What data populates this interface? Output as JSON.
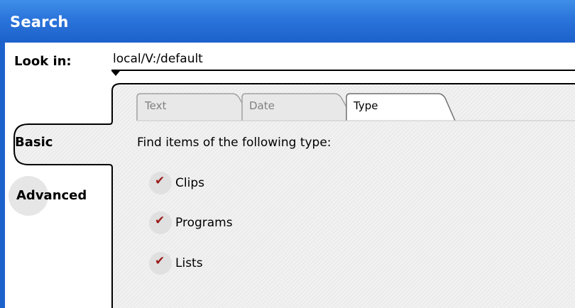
{
  "window": {
    "title": "Search"
  },
  "look_in": {
    "label": "Look in:",
    "value": "local/V:/default"
  },
  "side_tabs": [
    {
      "label": "Basic",
      "selected": true
    },
    {
      "label": "Advanced",
      "selected": false
    }
  ],
  "top_tabs": [
    {
      "label": "Text",
      "selected": false
    },
    {
      "label": "Date",
      "selected": false
    },
    {
      "label": "Type",
      "selected": true
    }
  ],
  "panel": {
    "heading": "Find items of the following type:",
    "items": [
      {
        "label": "Clips",
        "checked": true
      },
      {
        "label": "Programs",
        "checked": true
      },
      {
        "label": "Lists",
        "checked": true
      }
    ]
  },
  "colors": {
    "title_bar": "#2a74db",
    "checkmark": "#9b1b1b",
    "panel_background": "#f0f0f0"
  }
}
